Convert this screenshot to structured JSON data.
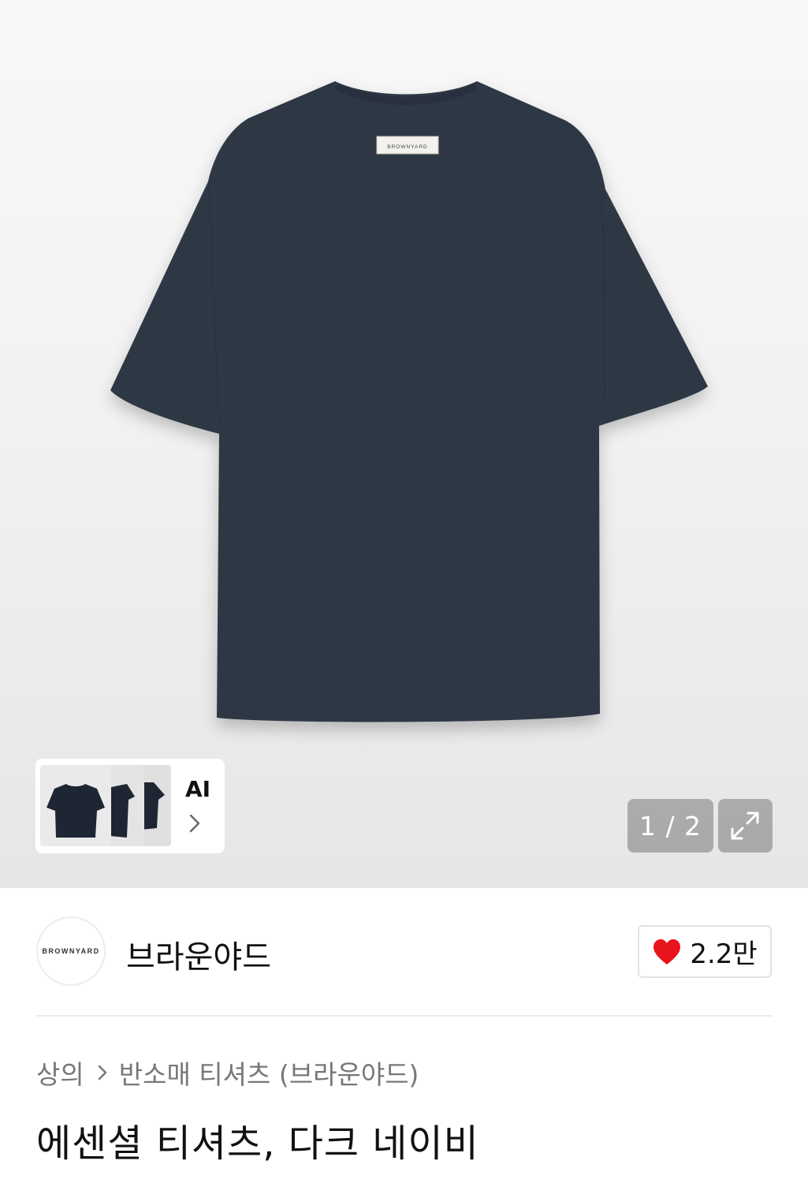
{
  "gallery": {
    "label_brand_tag": "BROWNYARD",
    "thumbnails": [
      "front",
      "side",
      "back"
    ],
    "ai_label": "AI",
    "page_counter": "1 / 2",
    "icons": {
      "expand": "expand-icon",
      "chevron": "chevron-right-icon"
    },
    "shirt_color": "#2f3845"
  },
  "brand": {
    "logo_text": "BROWNYARD",
    "name": "브라운야드",
    "likes": "2.2만",
    "heart_color": "#e8141b"
  },
  "breadcrumb": {
    "category": "상의",
    "subcategory": "반소매 티셔츠 (브라운야드)"
  },
  "product": {
    "title": "에센셜 티셔츠, 다크 네이비"
  }
}
